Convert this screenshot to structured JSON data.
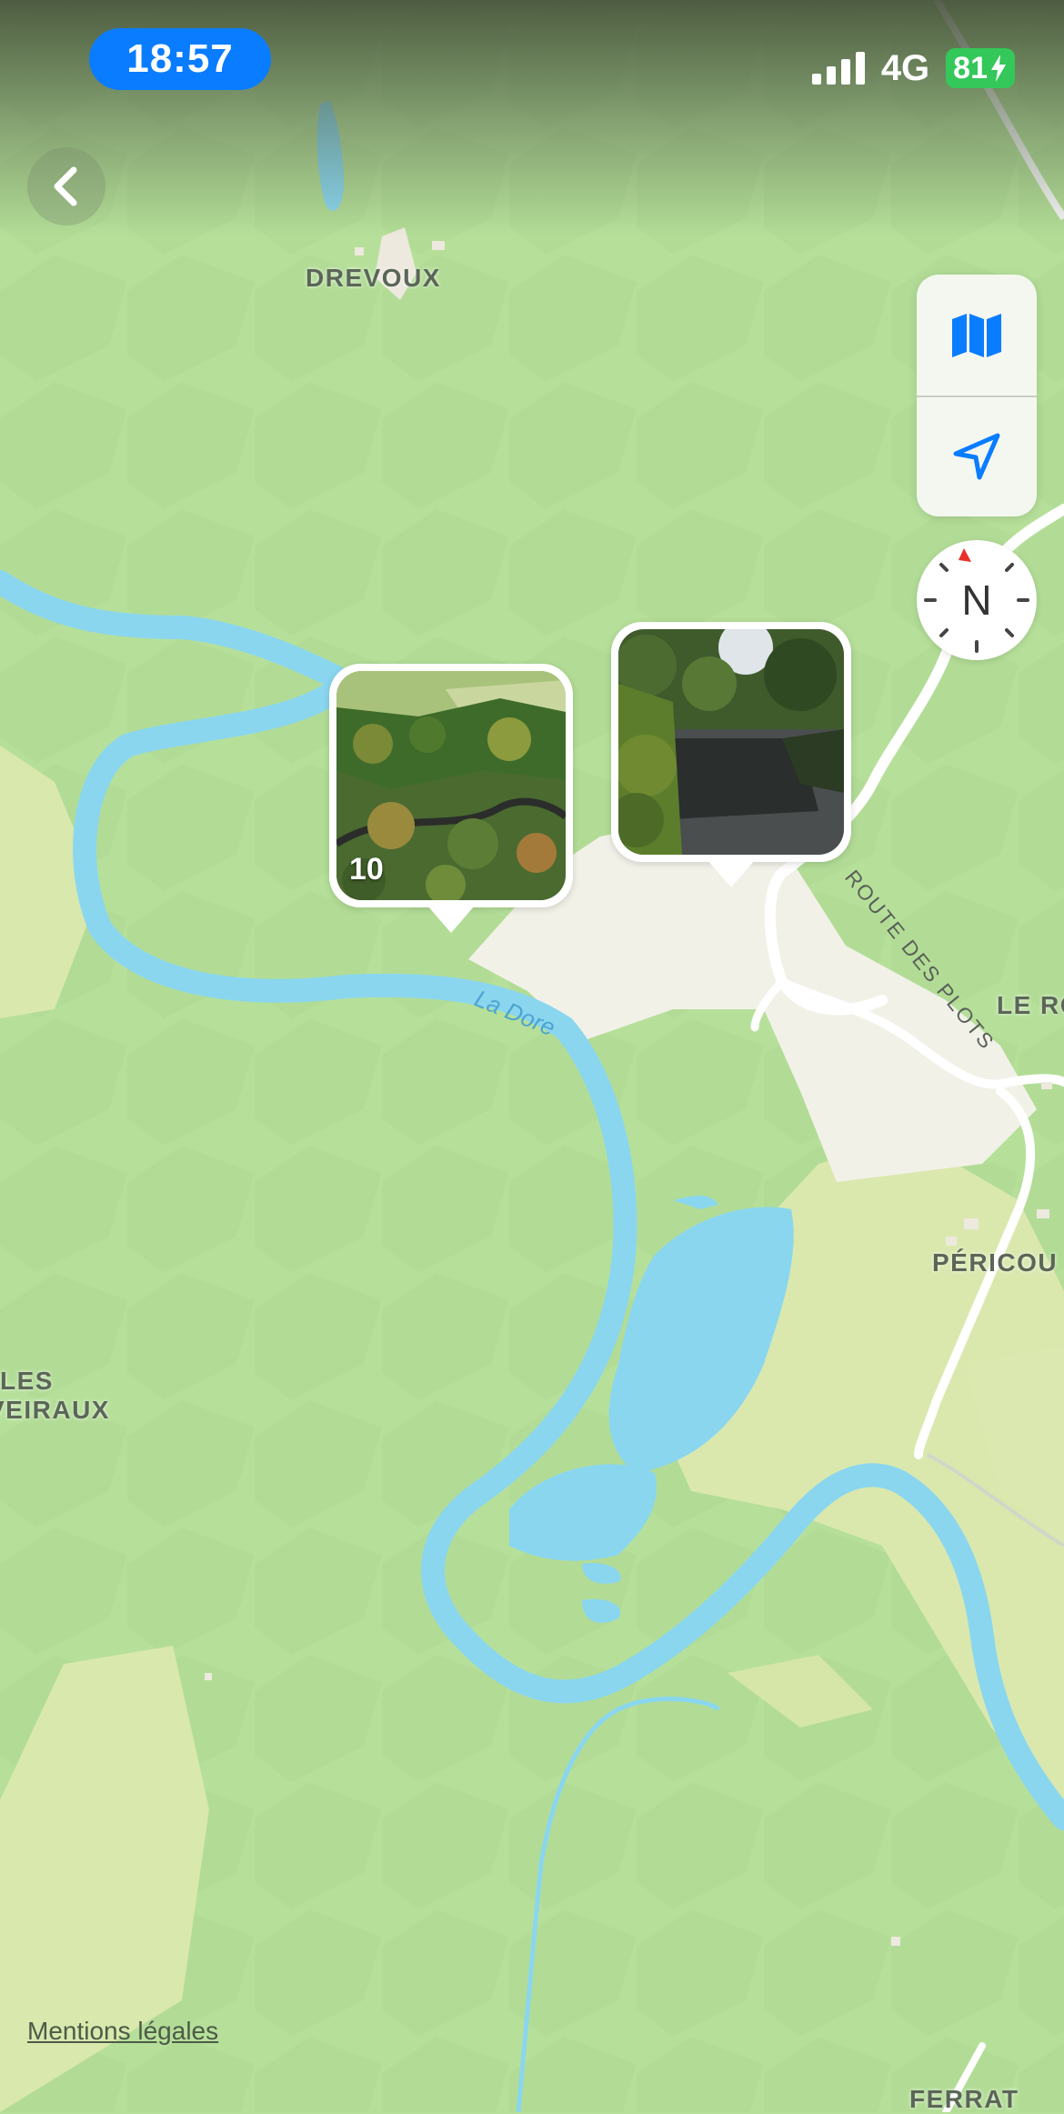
{
  "status_bar": {
    "time": "18:57",
    "network": "4G",
    "battery": "81"
  },
  "map": {
    "places": {
      "drevoux": "DREVOUX",
      "pericou": "PÉRICOU",
      "le_ro": "LE RO",
      "les": "LES",
      "veiraux": "VEIRAUX",
      "ferrat": "FERRAT"
    },
    "river_label": "La Dore",
    "road_label": "ROUTE DES PLOTS",
    "legal_link": "Mentions légales",
    "photo_clusters": [
      {
        "count": "10",
        "icon": "aerial-forest-photo"
      },
      {
        "count": "",
        "icon": "river-reflection-photo"
      }
    ]
  },
  "controls": {
    "map_mode_icon": "map-icon",
    "location_icon": "location-arrow-icon",
    "compass_label": "N"
  },
  "colors": {
    "land": "#b6e09a",
    "light_land": "#dde9b0",
    "water": "#8ad6ef",
    "urban": "#f2f1e8",
    "accent": "#0a7cff",
    "battery": "#34c759"
  }
}
